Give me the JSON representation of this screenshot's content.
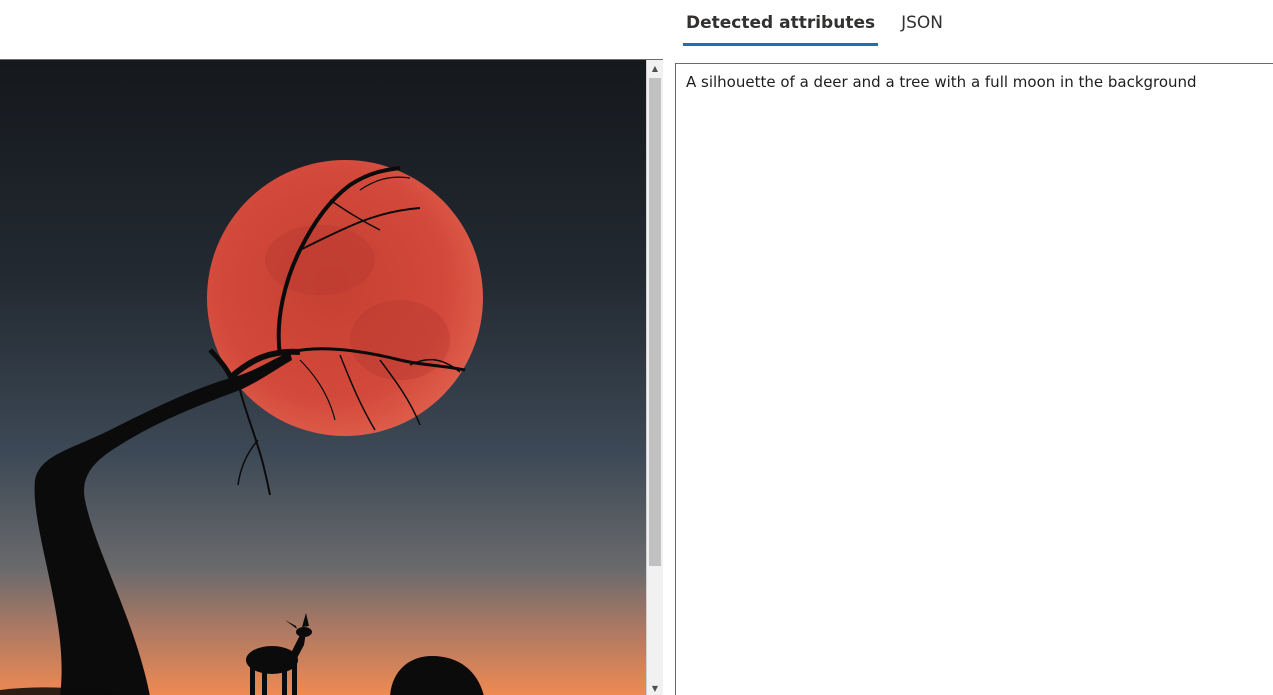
{
  "tabs": [
    {
      "label": "Detected attributes",
      "active": true
    },
    {
      "label": "JSON",
      "active": false
    }
  ],
  "results": {
    "caption": "A silhouette of a deer and a tree with a full moon in the background"
  },
  "image": {
    "subject": "deer and tree silhouette with red full moon at dusk",
    "colors": {
      "sky_top": "#16191d",
      "sky_mid": "#3a4755",
      "horizon": "#e8865a",
      "moon": "#d2463a",
      "silhouette": "#0b0b0b"
    }
  },
  "scrollbar": {
    "up_icon": "chevron-up-icon",
    "down_icon": "chevron-down-icon"
  }
}
